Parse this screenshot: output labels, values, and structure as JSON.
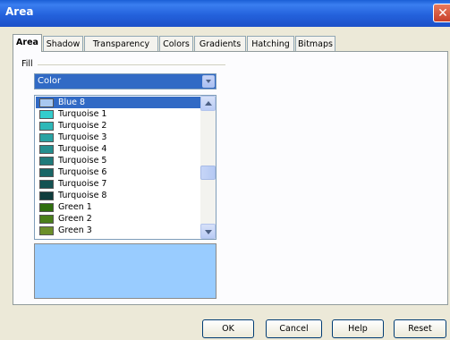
{
  "window": {
    "title": "Area",
    "close_glyph": "✕"
  },
  "tabs": [
    {
      "label": "Area",
      "active": true
    },
    {
      "label": "Shadow",
      "active": false
    },
    {
      "label": "Transparency",
      "active": false
    },
    {
      "label": "Colors",
      "active": false
    },
    {
      "label": "Gradients",
      "active": false
    },
    {
      "label": "Hatching",
      "active": false
    },
    {
      "label": "Bitmaps",
      "active": false
    }
  ],
  "fill": {
    "label": "Fill",
    "type_selected": "Color"
  },
  "color_list": {
    "items": [
      {
        "name": "Blue 8",
        "color": "#a8c8f0",
        "selected": true
      },
      {
        "name": "Turquoise 1",
        "color": "#33cccc",
        "selected": false
      },
      {
        "name": "Turquoise 2",
        "color": "#2eb8b8",
        "selected": false
      },
      {
        "name": "Turquoise 3",
        "color": "#29a3a3",
        "selected": false
      },
      {
        "name": "Turquoise 4",
        "color": "#248f8f",
        "selected": false
      },
      {
        "name": "Turquoise 5",
        "color": "#1f7a7a",
        "selected": false
      },
      {
        "name": "Turquoise 6",
        "color": "#196666",
        "selected": false
      },
      {
        "name": "Turquoise 7",
        "color": "#145252",
        "selected": false
      },
      {
        "name": "Turquoise 8",
        "color": "#0f3d3d",
        "selected": false
      },
      {
        "name": "Green 1",
        "color": "#2f6e0e",
        "selected": false
      },
      {
        "name": "Green 2",
        "color": "#4a7f1a",
        "selected": false
      },
      {
        "name": "Green 3",
        "color": "#6b8f2a",
        "selected": false
      }
    ]
  },
  "preview": {
    "color": "#99ccff"
  },
  "buttons": {
    "ok": "OK",
    "cancel": "Cancel",
    "help": "Help",
    "reset": "Reset"
  }
}
